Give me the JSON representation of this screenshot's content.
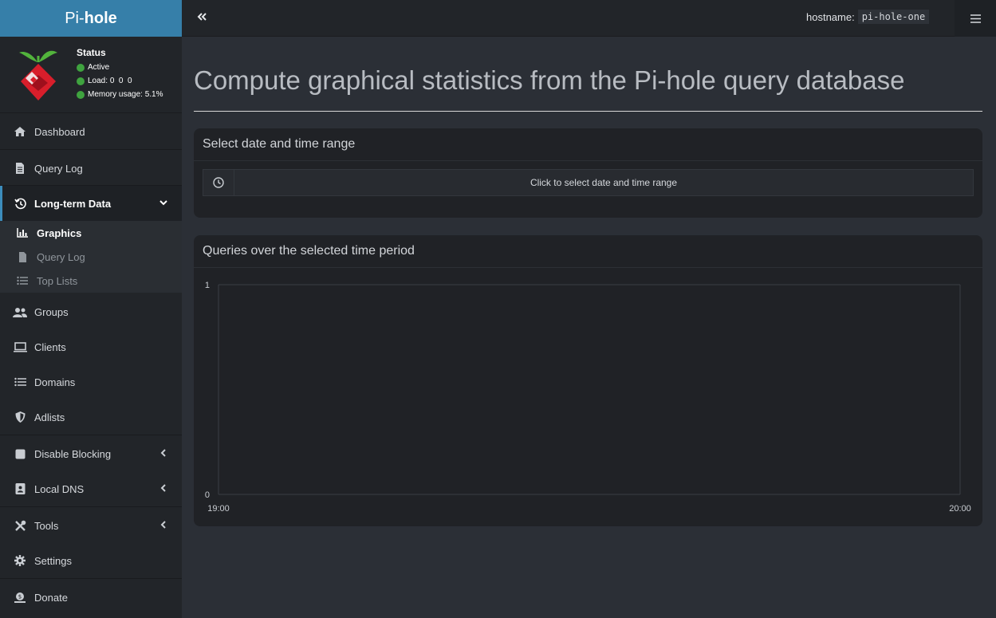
{
  "brand": {
    "prefix": "Pi-",
    "bold": "hole"
  },
  "status": {
    "title": "Status",
    "active": "Active",
    "load_label": "Load:",
    "load_value": "0  0  0",
    "memory_label": "Memory usage:",
    "memory_value": "5.1%",
    "indicator_color": "#3fa33f"
  },
  "topbar": {
    "hostname_label": "hostname:",
    "hostname_value": "pi-hole-one"
  },
  "menu": {
    "dashboard": "Dashboard",
    "query_log": "Query Log",
    "long_term": "Long-term Data",
    "sub": {
      "graphics": "Graphics",
      "query_log": "Query Log",
      "top_lists": "Top Lists"
    },
    "groups": "Groups",
    "clients": "Clients",
    "domains": "Domains",
    "adlists": "Adlists",
    "disable_blocking": "Disable Blocking",
    "local_dns": "Local DNS",
    "tools": "Tools",
    "settings": "Settings",
    "donate": "Donate"
  },
  "page": {
    "title": "Compute graphical statistics from the Pi-hole query database"
  },
  "range_box": {
    "title": "Select date and time range",
    "button": "Click to select date and time range"
  },
  "chart_box": {
    "title": "Queries over the selected time period"
  },
  "chart_data": {
    "type": "bar",
    "categories": [],
    "values": [],
    "title": "Queries over the selected time period",
    "xlabel": "",
    "ylabel": "",
    "x_tick_labels": [
      "19:00",
      "20:00"
    ],
    "y_tick_labels": [
      "0",
      "1"
    ],
    "ylim": [
      0,
      1
    ],
    "grid": false
  },
  "colors": {
    "accent": "#367fa9",
    "active_border": "#3c8dbc"
  }
}
